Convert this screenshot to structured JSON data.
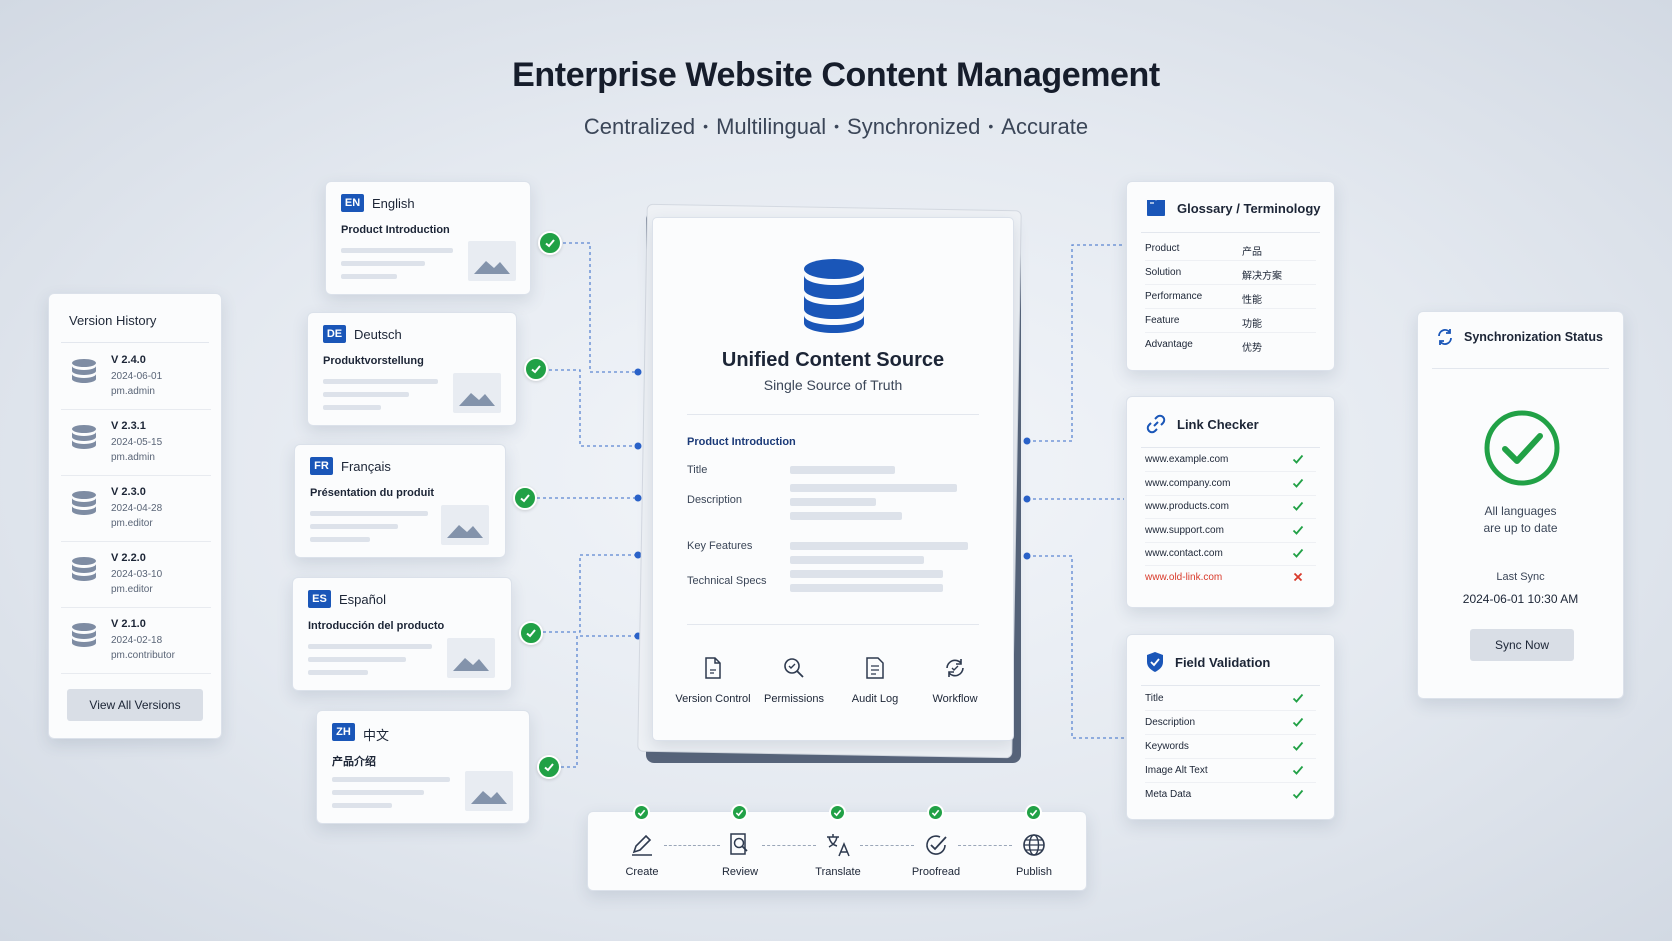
{
  "header": {
    "title": "Enterprise Website Content Management",
    "subtitle": [
      "Centralized",
      "Multilingual",
      "Synchronized",
      "Accurate"
    ]
  },
  "version_history": {
    "title": "Version History",
    "versions": [
      {
        "version": "V 2.4.0",
        "date": "2024-06-01",
        "user": "pm.admin"
      },
      {
        "version": "V 2.3.1",
        "date": "2024-05-15",
        "user": "pm.admin"
      },
      {
        "version": "V 2.3.0",
        "date": "2024-04-28",
        "user": "pm.editor"
      },
      {
        "version": "V 2.2.0",
        "date": "2024-03-10",
        "user": "pm.editor"
      },
      {
        "version": "V 2.1.0",
        "date": "2024-02-18",
        "user": "pm.contributor"
      }
    ],
    "view_all_label": "View All Versions"
  },
  "languages": [
    {
      "code": "EN",
      "name": "English",
      "title": "Product Introduction"
    },
    {
      "code": "DE",
      "name": "Deutsch",
      "title": "Produktvorstellung"
    },
    {
      "code": "FR",
      "name": "Français",
      "title": "Présentation du produit"
    },
    {
      "code": "ES",
      "name": "Español",
      "title": "Introducción del producto"
    },
    {
      "code": "ZH",
      "name": "中文",
      "title": "产品介绍"
    }
  ],
  "central": {
    "title": "Unified Content Source",
    "subtitle": "Single Source of Truth",
    "section": "Product Introduction",
    "fields": [
      "Title",
      "Description",
      "Key Features",
      "Technical Specs"
    ],
    "tools": [
      "Version Control",
      "Permissions",
      "Audit Log",
      "Workflow"
    ]
  },
  "glossary": {
    "title": "Glossary / Terminology",
    "terms": [
      {
        "en": "Product",
        "zh": "产品"
      },
      {
        "en": "Solution",
        "zh": "解决方案"
      },
      {
        "en": "Performance",
        "zh": "性能"
      },
      {
        "en": "Feature",
        "zh": "功能"
      },
      {
        "en": "Advantage",
        "zh": "优势"
      }
    ]
  },
  "link_checker": {
    "title": "Link Checker",
    "links": [
      {
        "url": "www.example.com",
        "ok": true
      },
      {
        "url": "www.company.com",
        "ok": true
      },
      {
        "url": "www.products.com",
        "ok": true
      },
      {
        "url": "www.support.com",
        "ok": true
      },
      {
        "url": "www.contact.com",
        "ok": true
      },
      {
        "url": "www.old-link.com",
        "ok": false
      }
    ]
  },
  "field_validation": {
    "title": "Field Validation",
    "fields": [
      "Title",
      "Description",
      "Keywords",
      "Image Alt Text",
      "Meta Data"
    ]
  },
  "sync": {
    "title": "Synchronization Status",
    "message_line1": "All languages",
    "message_line2": "are up to date",
    "last_sync_label": "Last Sync",
    "last_sync_value": "2024-06-01 10:30 AM",
    "button_label": "Sync Now"
  },
  "workflow": {
    "steps": [
      "Create",
      "Review",
      "Translate",
      "Proofread",
      "Publish"
    ]
  },
  "colors": {
    "accent": "#1a56b8",
    "success": "#21a146",
    "error": "#d93a2b"
  }
}
